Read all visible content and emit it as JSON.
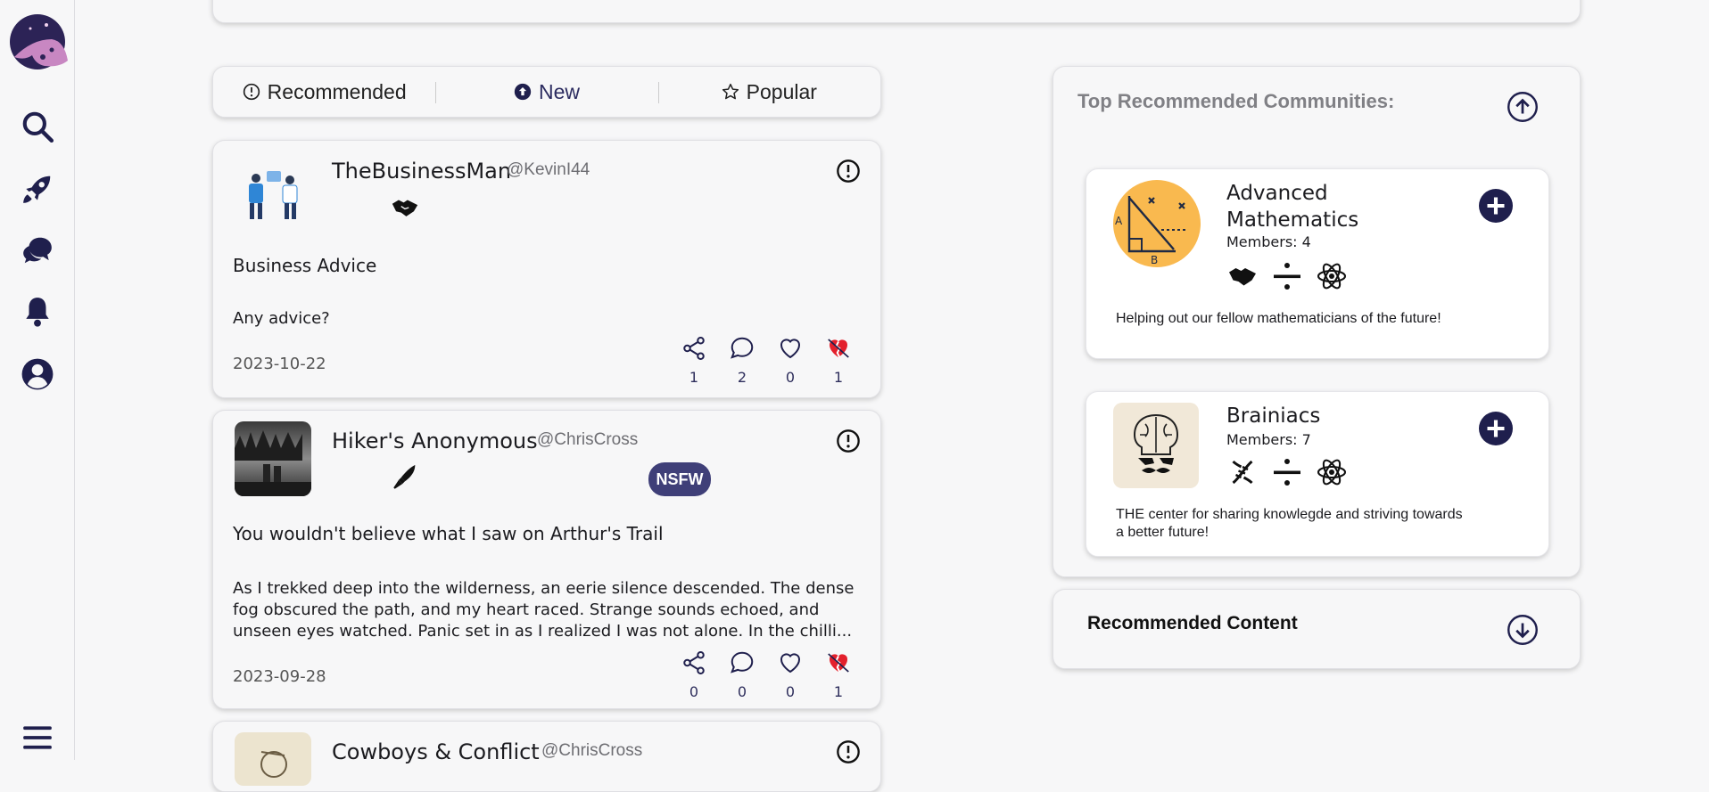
{
  "nav": {
    "items": [
      {
        "name": "search-icon"
      },
      {
        "name": "rocket-icon"
      },
      {
        "name": "chat-icon"
      },
      {
        "name": "bell-icon"
      },
      {
        "name": "profile-icon"
      }
    ],
    "menu_icon": "hamburger-menu-icon"
  },
  "tabs": [
    {
      "label": "Recommended",
      "icon": "info-circle-icon"
    },
    {
      "label": "New",
      "icon": "arrow-up-circle-icon"
    },
    {
      "label": "Popular",
      "icon": "star-icon"
    }
  ],
  "posts": [
    {
      "name": "TheBusinessMan",
      "handle": "@KevinI44",
      "tag_icon": "handshake-icon",
      "title": "Business Advice",
      "body": "Any advice?",
      "date": "2023-10-22",
      "shares": "1",
      "comments": "2",
      "likes": "0",
      "dislikes": "1"
    },
    {
      "name": "Hiker's Anonymous",
      "handle": "@ChrisCross",
      "tag_icon": "knife-icon",
      "badge": "NSFW",
      "title": "You wouldn't believe what I saw on Arthur's Trail",
      "body": "As I trekked deep into the wilderness, an eerie silence descended. The dense fog obscured the path, and my heart raced. Strange sounds echoed, and unseen eyes watched. Panic set in as I realized I was not alone. In the chilli...",
      "date": "2023-09-28",
      "shares": "0",
      "comments": "0",
      "likes": "0",
      "dislikes": "1"
    },
    {
      "name": "Cowboys & Conflict",
      "handle": "@ChrisCross"
    }
  ],
  "right_panel": {
    "title": "Top Recommended Communities:",
    "communities": [
      {
        "name": "Advanced Mathematics",
        "members": "Members: 4",
        "description": "Helping out our fellow mathematicians of the future!"
      },
      {
        "name": "Brainiacs",
        "members": "Members: 7",
        "description": "THE center for sharing knowlegde and striving towards a better future!"
      }
    ]
  },
  "recommended_content": {
    "title": "Recommended Content"
  },
  "colors": {
    "accent": "#1f1f4d",
    "like_red": "#e3202c",
    "badge": "#3f3f78",
    "math_orange": "#f9b94f"
  }
}
